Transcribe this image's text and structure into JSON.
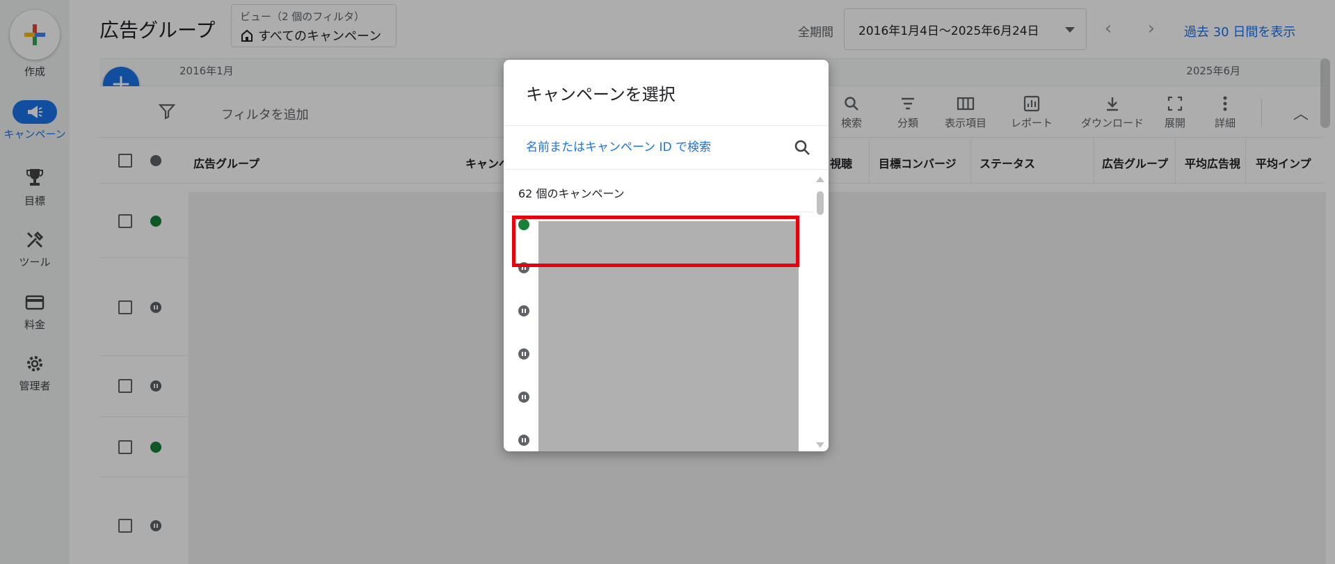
{
  "nav": {
    "create_label": "作成",
    "items": [
      {
        "label": "キャンペーン",
        "icon": "megaphone-icon"
      },
      {
        "label": "目標",
        "icon": "trophy-icon"
      },
      {
        "label": "ツール",
        "icon": "tools-icon"
      },
      {
        "label": "料金",
        "icon": "credit-card-icon"
      },
      {
        "label": "管理者",
        "icon": "gear-icon"
      }
    ]
  },
  "header": {
    "title": "広告グループ",
    "view_chip_sub": "ビュー（2 個のフィルタ）",
    "view_chip_main": "すべてのキャンペーン",
    "period_label": "全期間",
    "date_range": "2016年1月4日～2025年6月24日",
    "last30": "過去 30 日間を表示"
  },
  "timeline": {
    "start": "2016年1月",
    "end": "2025年6月"
  },
  "toolbar": {
    "filter_label": "フィルタを追加",
    "buttons": [
      "検索",
      "分類",
      "表示項目",
      "レポート",
      "ダウンロード",
      "展開",
      "詳細"
    ]
  },
  "table": {
    "columns": [
      "広告グループ",
      "キャンペ",
      "視聴",
      "目標コンバージ",
      "ステータス",
      "広告グループの",
      "平均広告視",
      "平均インプ"
    ],
    "row_statuses": [
      "enabled",
      "paused",
      "paused",
      "enabled",
      "paused"
    ]
  },
  "dialog": {
    "title": "キャンペーンを選択",
    "search_placeholder": "名前またはキャンペーン ID で検索",
    "count_label": "62 個のキャンペーン",
    "item_statuses": [
      "enabled",
      "paused",
      "paused",
      "paused",
      "paused",
      "paused"
    ]
  },
  "colors": {
    "accent": "#1a73e8",
    "enabled": "#188038",
    "paused": "#5f6368",
    "highlight": "#e8000b"
  }
}
